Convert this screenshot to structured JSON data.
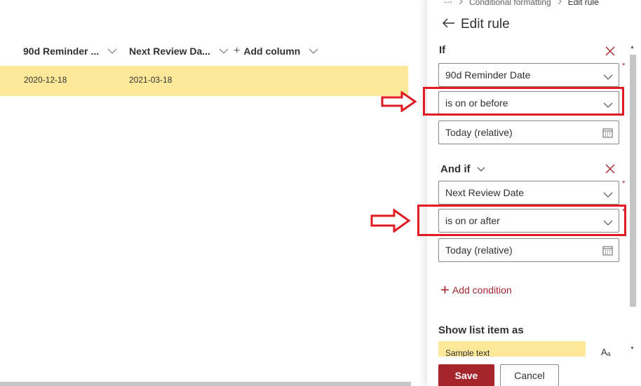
{
  "list": {
    "columns": [
      {
        "label": "90d Reminder ..."
      },
      {
        "label": "Next Review Da..."
      }
    ],
    "add_column_label": "Add column",
    "row": [
      "2020-12-18",
      "2021-03-18"
    ]
  },
  "panel": {
    "breadcrumb": {
      "more": "⋯",
      "items": [
        "Conditional formatting",
        "Edit rule"
      ]
    },
    "title": "Edit rule",
    "if_label": "If",
    "and_if_label": "And if",
    "condition_1": {
      "field": "90d Reminder Date",
      "operator": "is on or before",
      "value": "Today (relative)"
    },
    "condition_2": {
      "field": "Next Review Date",
      "operator": "is on or after",
      "value": "Today (relative)"
    },
    "required_marker": "*",
    "add_condition_label": "Add condition",
    "show_list_item_as": "Show list item as",
    "sample_text": "Sample text",
    "font_icon_label": "Aₐ",
    "save_label": "Save",
    "cancel_label": "Cancel"
  },
  "colors": {
    "accent": "#a4262c",
    "highlight": "#fde89a",
    "annotation_red": "#e01b24"
  }
}
